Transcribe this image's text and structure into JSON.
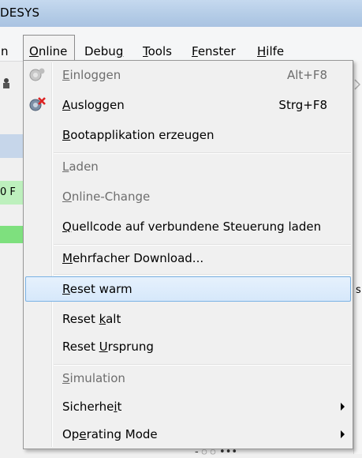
{
  "window": {
    "title_fragment": "DESYS"
  },
  "menubar": {
    "items": [
      {
        "label": "n"
      },
      {
        "label": "Online",
        "accel": "O",
        "rest": "nline"
      },
      {
        "label": "Debug",
        "pre": "Debu",
        "accel": "g",
        "rest": ""
      },
      {
        "label": "Tools",
        "accel": "T",
        "rest": "ools"
      },
      {
        "label": "Fenster",
        "accel": "F",
        "rest": "enster"
      },
      {
        "label": "Hilfe",
        "accel": "H",
        "rest": "ilfe"
      }
    ]
  },
  "background": {
    "left_green_text": "0 F",
    "right_s": "s",
    "bottom_peek": "- ॅ ॅ •••"
  },
  "menu": {
    "items": [
      {
        "accel": "E",
        "rest": "inloggen",
        "shortcut": "Alt+F8",
        "disabled": true,
        "icon": "login-icon"
      },
      {
        "accel": "A",
        "rest": "usloggen",
        "shortcut": "Strg+F8",
        "disabled": false,
        "icon": "logout-icon"
      },
      {
        "accel": "B",
        "rest": "ootapplikation erzeugen",
        "disabled": false
      },
      {
        "accel": "L",
        "rest": "aden",
        "disabled": true
      },
      {
        "accel": "O",
        "rest": "nline-Change",
        "disabled": true
      },
      {
        "accel": "Q",
        "rest": "uellcode auf verbundene Steuerung laden",
        "disabled": false
      },
      {
        "accel": "M",
        "rest": "ehrfacher Download...",
        "disabled": false
      },
      {
        "accel": "R",
        "rest": "eset warm",
        "disabled": false,
        "highlighted": true
      },
      {
        "pre": "Reset ",
        "accel": "k",
        "rest": "alt",
        "disabled": false
      },
      {
        "pre": "Reset ",
        "accel": "U",
        "rest": "rsprung",
        "disabled": false
      },
      {
        "accel": "S",
        "rest": "imulation",
        "disabled": true
      },
      {
        "pre": "Sicherhe",
        "accel": "i",
        "rest": "t",
        "disabled": false,
        "submenu": true
      },
      {
        "pre": "Op",
        "accel": "e",
        "rest": "rating Mode",
        "disabled": false,
        "submenu": true
      }
    ]
  },
  "colors": {
    "highlight_border": "#7ab2e4",
    "disabled_text": "#6d6d6d",
    "titlebar": "#b3cbe6"
  }
}
